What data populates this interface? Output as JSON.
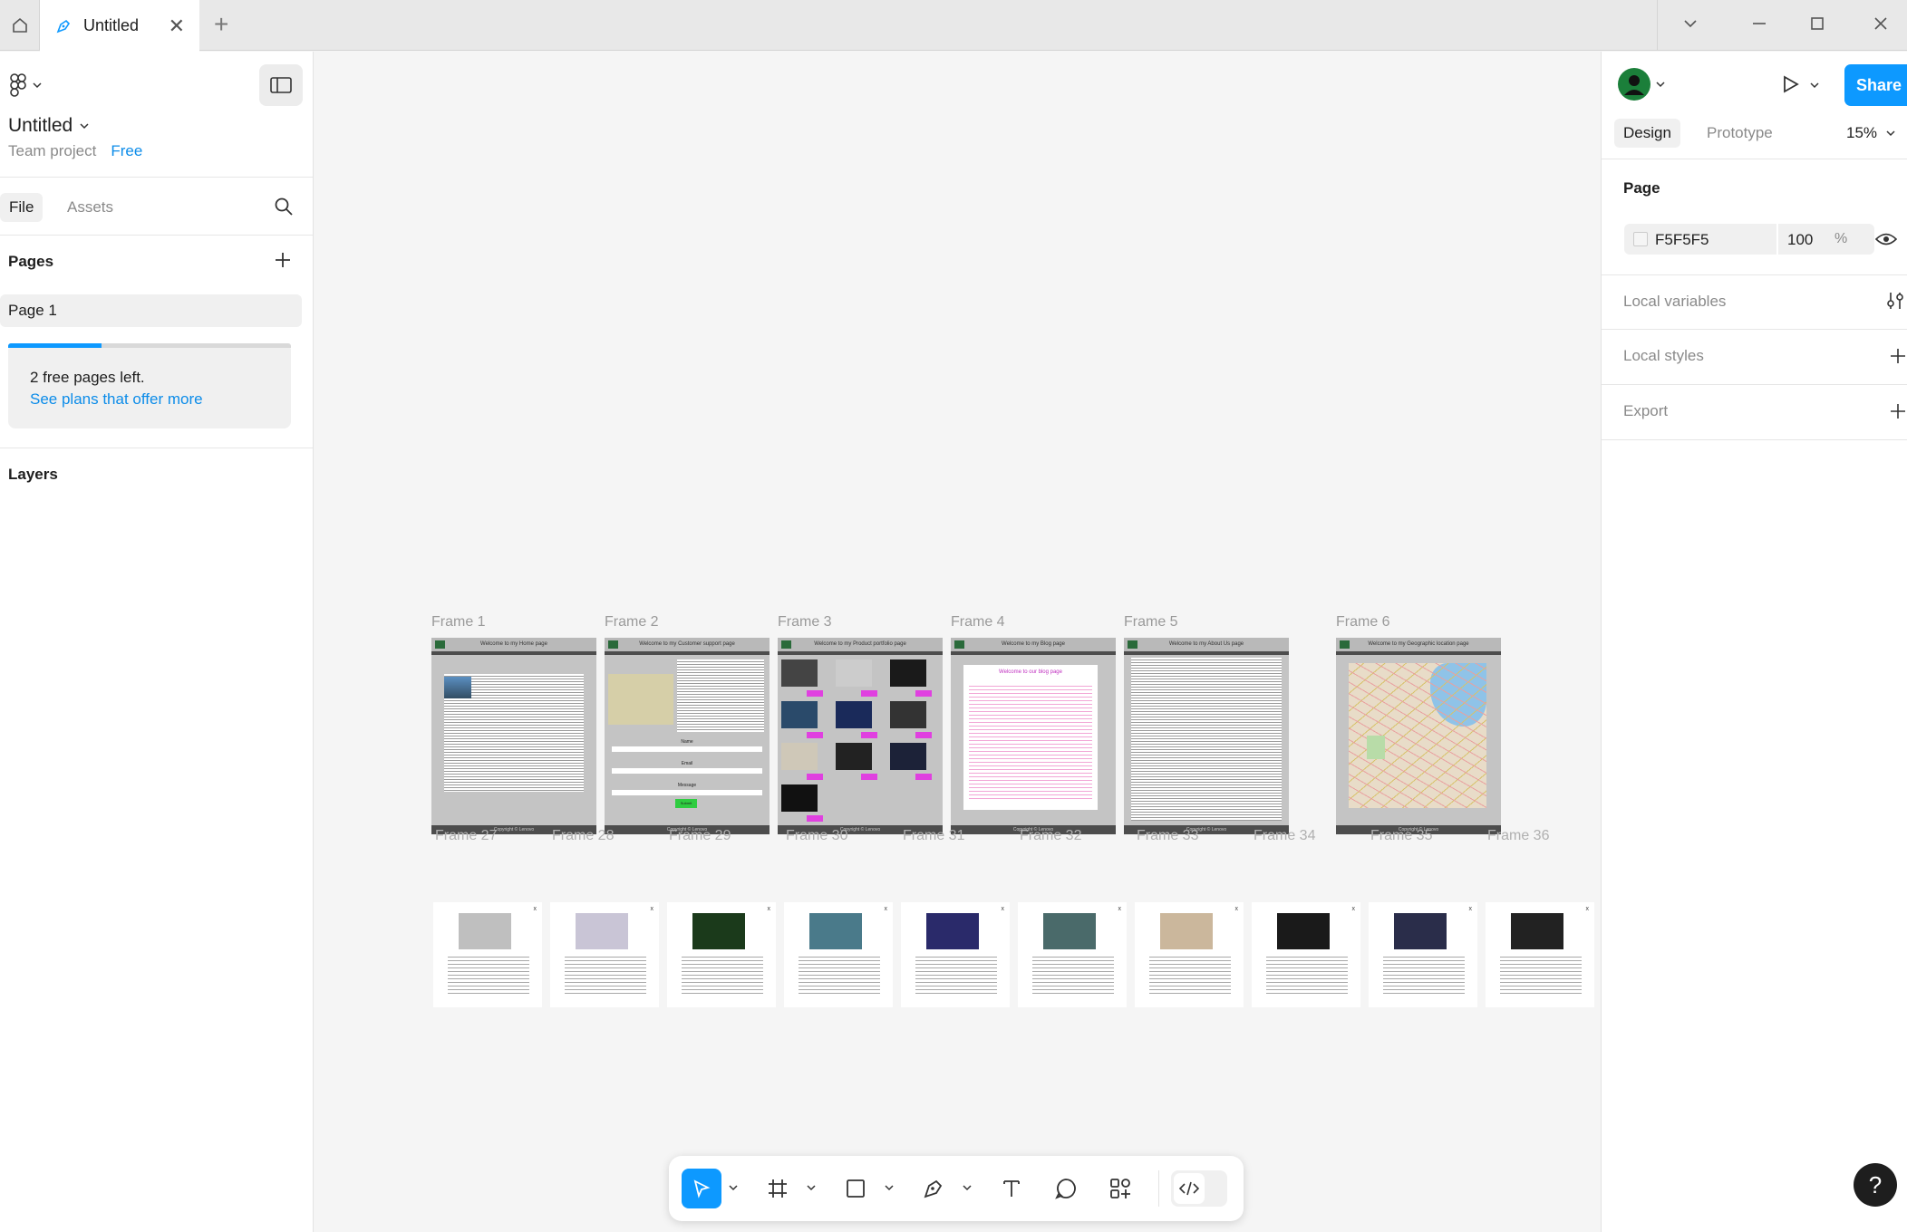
{
  "tabbar": {
    "tab_title": "Untitled"
  },
  "left_panel": {
    "file_name": "Untitled",
    "team_label": "Team project",
    "plan_badge": "Free",
    "tabs": [
      {
        "label": "File"
      },
      {
        "label": "Assets"
      }
    ],
    "pages_title": "Pages",
    "pages": [
      {
        "label": "Page 1"
      }
    ],
    "promo_line1": "2 free pages left.",
    "promo_link": "See plans that offer more",
    "promo_progress": 0.33,
    "layers_title": "Layers"
  },
  "right_panel": {
    "share_label": "Share",
    "tabs": [
      {
        "label": "Design"
      },
      {
        "label": "Prototype"
      }
    ],
    "zoom": "15%",
    "page_title": "Page",
    "page_color": "F5F5F5",
    "page_opacity": "100",
    "percent_sign": "%",
    "sections": [
      {
        "label": "Local variables"
      },
      {
        "label": "Local styles"
      },
      {
        "label": "Export"
      }
    ]
  },
  "canvas": {
    "frames_top": [
      {
        "label": "Frame 1",
        "heading": "Welcome to my Home page",
        "footer": "Copyright © Lenovo"
      },
      {
        "label": "Frame 2",
        "heading": "Welcome to my Customer support page",
        "footer": "Copyright © Lenovo"
      },
      {
        "label": "Frame 3",
        "heading": "Welcome to my Product portfolio page",
        "footer": "Copyright © Lenovo"
      },
      {
        "label": "Frame 4",
        "heading": "Welcome to my Blog page",
        "footer": "Copyright © Lenovo"
      },
      {
        "label": "Frame 5",
        "heading": "Welcome to my About Us page",
        "footer": "Copyright © Lenovo"
      },
      {
        "label": "Frame 6",
        "heading": "Welcome to my Geographic location page",
        "footer": "Copyright © Lenovo"
      }
    ],
    "frames_bottom": [
      {
        "label": "Frame 27"
      },
      {
        "label": "Frame 28"
      },
      {
        "label": "Frame 29"
      },
      {
        "label": "Frame 30"
      },
      {
        "label": "Frame 31"
      },
      {
        "label": "Frame 32"
      },
      {
        "label": "Frame 33"
      },
      {
        "label": "Frame 34"
      },
      {
        "label": "Frame 35"
      },
      {
        "label": "Frame 36"
      }
    ],
    "frame2_fields": [
      "Name",
      "Email",
      "Message"
    ],
    "frame2_submit": "Submit",
    "frame4_heading": "Welcome to our blog page"
  },
  "colors": {
    "accent": "#0d99ff",
    "canvas": "#F5F5F5",
    "frame_gray": "#c4c4c4",
    "magenta": "#e040e0"
  },
  "toolbar": {
    "tools": [
      "move",
      "frame",
      "shape",
      "pen",
      "text",
      "comment",
      "actions",
      "dev-mode"
    ]
  },
  "help_label": "?"
}
